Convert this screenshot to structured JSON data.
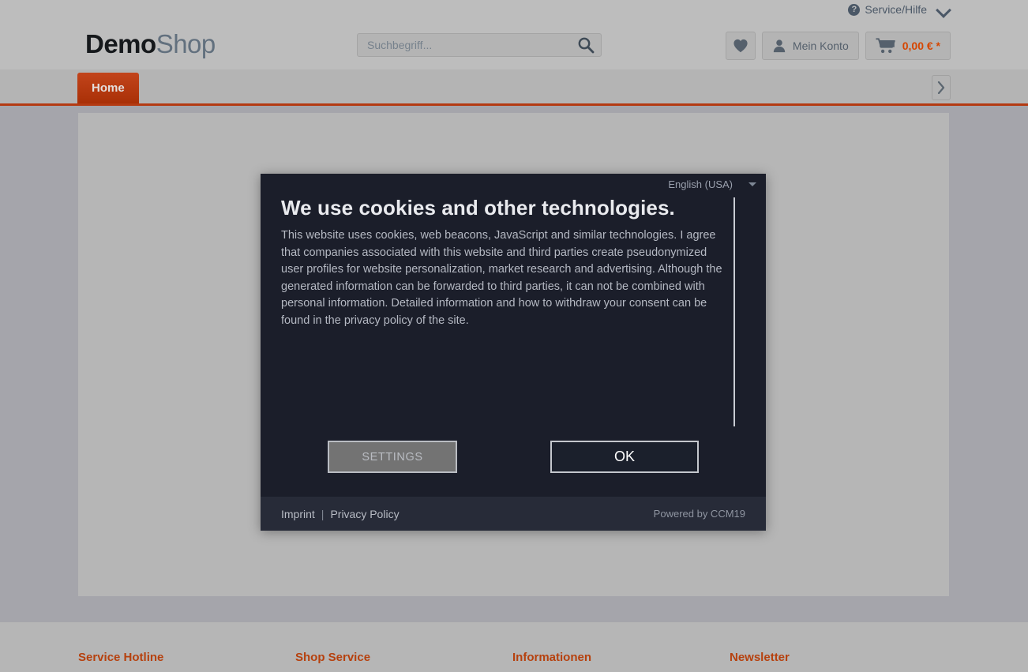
{
  "top_bar": {
    "service_help": "Service/Hilfe",
    "help_icon": "question-circle-icon",
    "chevron_icon": "chevron-down-icon"
  },
  "header": {
    "logo_primary": "Demo",
    "logo_secondary": "Shop",
    "search": {
      "placeholder": "Suchbegriff...",
      "value": "",
      "icon": "search-icon"
    },
    "actions": {
      "wishlist_icon": "heart-icon",
      "account_icon": "user-icon",
      "account_label": "Mein Konto",
      "cart_icon": "shopping-cart-icon",
      "cart_total": "0,00 € *"
    }
  },
  "nav": {
    "items": [
      {
        "label": "Home",
        "active": true
      }
    ],
    "next_icon": "chevron-right-icon"
  },
  "cookie_dialog": {
    "language": {
      "selected": "English (USA)",
      "caret_icon": "caret-down-icon"
    },
    "title": "We use cookies and other technologies.",
    "body": "This website uses cookies, web beacons, JavaScript and similar technologies. I agree that companies associated with this website and third parties create pseudonymized user profiles for website personalization, market research and advertising. Although the generated information can be forwarded to third parties, it can not be combined with personal information. Detailed information and how to withdraw your consent can be found in the privacy policy of the site.",
    "buttons": {
      "settings": "SETTINGS",
      "ok": "OK"
    },
    "footer": {
      "imprint": "Imprint",
      "separator": "|",
      "privacy_policy": "Privacy Policy",
      "powered_by": "Powered by CCM19"
    }
  },
  "site_footer": {
    "columns": [
      {
        "heading": "Service Hotline"
      },
      {
        "heading": "Shop Service"
      },
      {
        "heading": "Informationen"
      },
      {
        "heading": "Newsletter"
      }
    ]
  },
  "colors": {
    "accent": "#b6410e",
    "nav_active": "#a93007",
    "price": "#d64600",
    "dialog_bg": "#1b1e2a",
    "dialog_footer_bg": "#272b38",
    "page_bg": "#a5a5ab",
    "header_bg": "#bdbdbd"
  }
}
